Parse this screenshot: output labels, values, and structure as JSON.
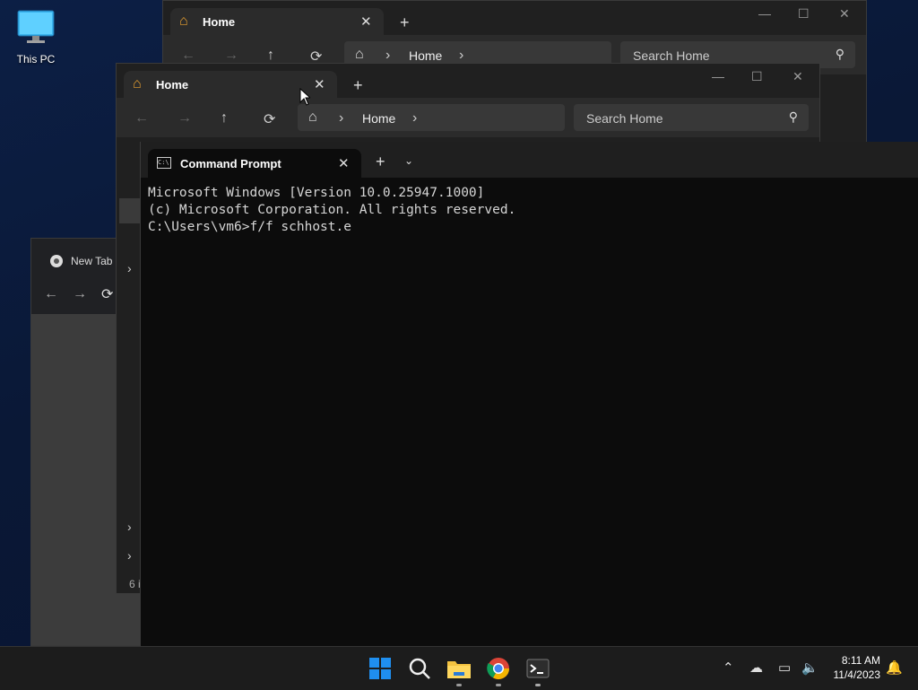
{
  "desktop": {
    "icon_label": "This PC"
  },
  "explorer_back": {
    "tab_title": "Home",
    "crumb": "Home",
    "search_placeholder": "Search Home"
  },
  "explorer_front": {
    "tab_title": "Home",
    "crumb": "Home",
    "search_placeholder": "Search Home",
    "status_partial": "6 i"
  },
  "chrome": {
    "tab_title": "New Tab"
  },
  "cmd": {
    "tab_title": "Command Prompt",
    "lines": [
      "Microsoft Windows [Version 10.0.25947.1000]",
      "(c) Microsoft Corporation. All rights reserved.",
      "",
      "C:\\Users\\vm6>f/f schhost.e"
    ]
  },
  "taskbar": {
    "apps": [
      "start-icon",
      "search-icon",
      "file-explorer-icon",
      "chrome-icon",
      "terminal-icon"
    ],
    "time": "8:11 AM",
    "date": "11/4/2023"
  },
  "colors": {
    "accent_orange": "#e8a030",
    "start_blue": "#1f8ff0",
    "console_bg": "#0c0c0c"
  }
}
